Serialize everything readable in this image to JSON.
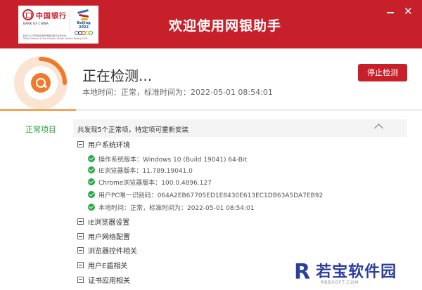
{
  "window": {
    "title": "欢迎使用网银助手",
    "minimize_icon": "minimize-icon",
    "close_glyph": "✕"
  },
  "brand": {
    "bank_cn": "中国银行",
    "bank_en": "BANK OF CHINA",
    "note_cn": "北京2022年冬奥会和冬残奥会官方合作伙伴",
    "note_en": "Official Partner of the Olympic Winter Games Beijing 2022",
    "olympic_label": "Beijing 2022",
    "accent": "#c8202a"
  },
  "status": {
    "title": "正在检测...",
    "time_text": "本地时间：正常，标准时间为：2022-05-01 08:54:01",
    "stop_button": "停止检测",
    "progress": 0.18,
    "progress_color": "#f5a25d"
  },
  "results": {
    "side_label": "正常项目",
    "summary": "共发现5个正常项，特定项可重新安装",
    "groups": [
      {
        "label": "用户系统环境",
        "items": [
          "操作系统版本：Windows 10  (Build 19041) 64-Bit",
          "IE浏览器版本：11.789.19041.0",
          "Chrome浏览器版本：100.0.4896.127",
          "用户PC唯一识别码：064A2EB67705ED1E8430E613EC1DB63A5DA7EB92",
          "本地时间：正常，标准时间为：2022-05-01 08:54:01"
        ]
      },
      {
        "label": "IE浏览器设置"
      },
      {
        "label": "用户网络配置"
      },
      {
        "label": "浏览器控件相关"
      },
      {
        "label": "用户E盾相关"
      },
      {
        "label": "证书应用相关"
      }
    ]
  },
  "watermark": {
    "mark": "R",
    "text": "若宝软件园",
    "url": "RBBSOFT.COM"
  }
}
